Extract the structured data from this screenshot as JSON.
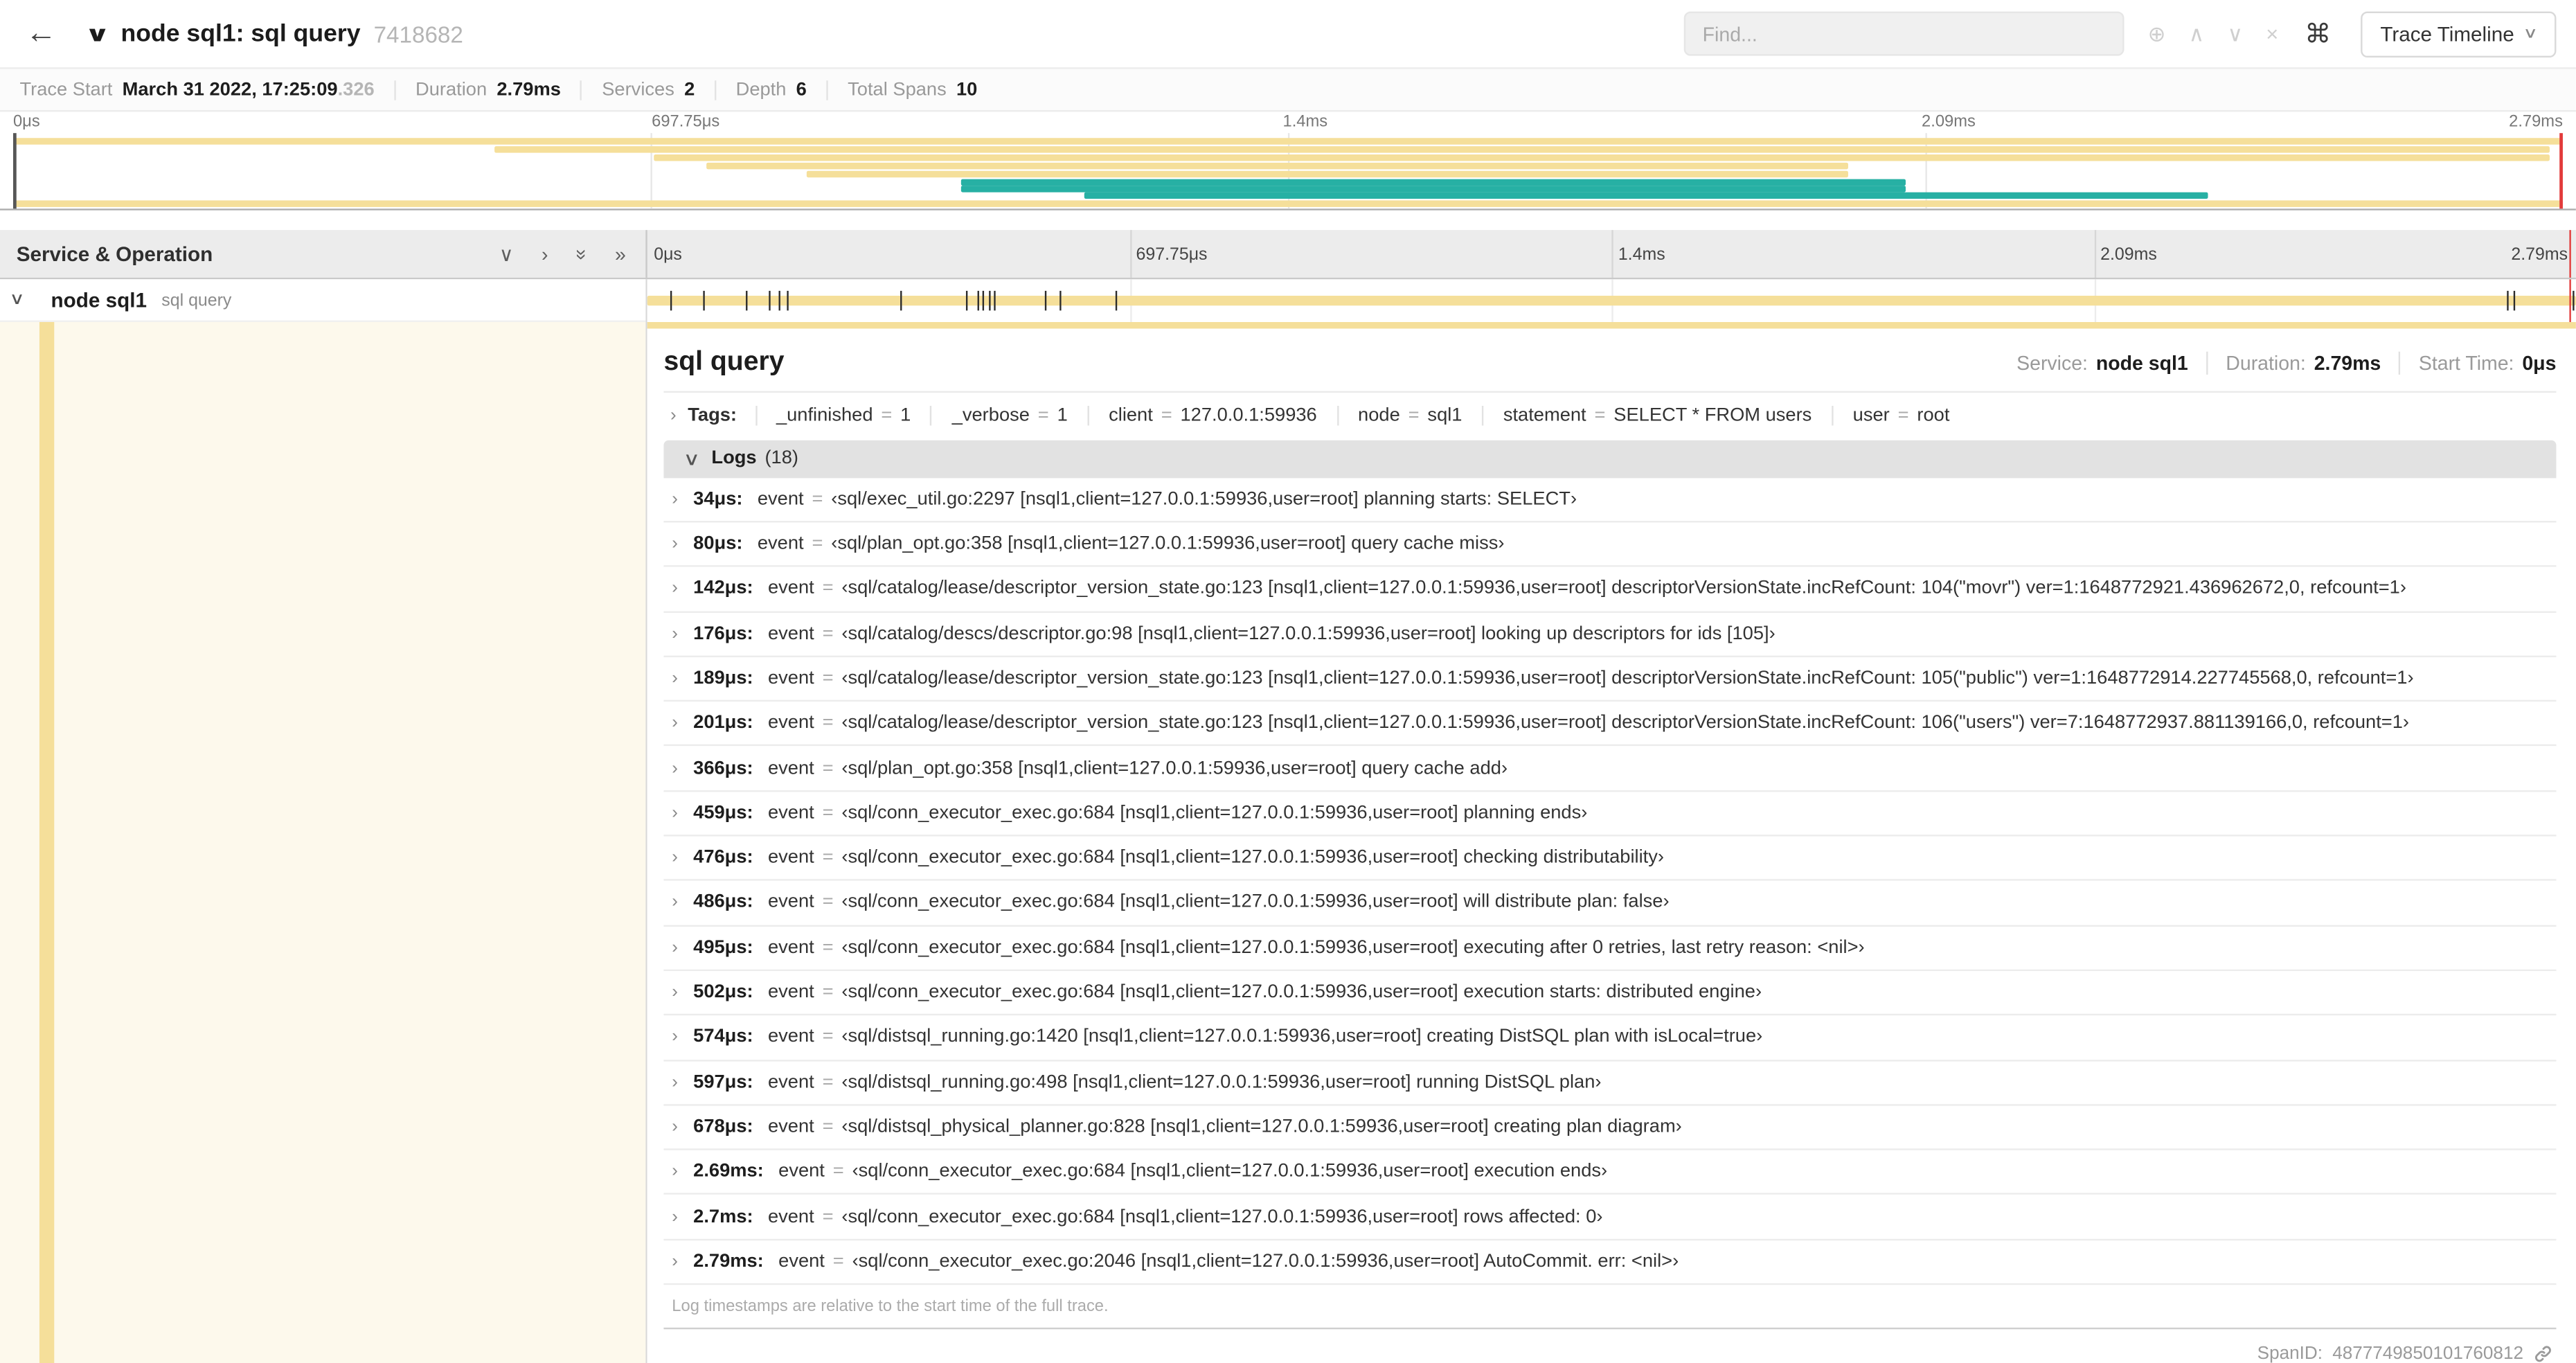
{
  "icons": {
    "back": "←",
    "title_chevron": "∨",
    "find_zoom": "⊕",
    "prev_result": "∧",
    "next_result": "∨",
    "clear_search": "×",
    "keyboard_shortcuts": "⌘",
    "dropdown_caret": "∨",
    "collapse_one": "∨",
    "expand_one": "›",
    "collapse_all": "»",
    "expand_all": "»",
    "span_toggle": "∨",
    "chevron_right": "›",
    "chevron_down": "∨"
  },
  "header": {
    "title": "node sql1: sql query",
    "trace_id": "7418682",
    "find_placeholder": "Find...",
    "trace_timeline_label": "Trace Timeline"
  },
  "summary": {
    "trace_start_label": "Trace Start",
    "trace_start_value": "March 31 2022, 17:25:09",
    "trace_start_ms": ".326",
    "duration_label": "Duration",
    "duration_value": "2.79ms",
    "services_label": "Services",
    "services_value": "2",
    "depth_label": "Depth",
    "depth_value": "6",
    "total_spans_label": "Total Spans",
    "total_spans_value": "10"
  },
  "ticks": [
    "0μs",
    "697.75μs",
    "1.4ms",
    "2.09ms",
    "2.79ms"
  ],
  "minimap": {
    "bars": [
      {
        "t": 3,
        "l": 0,
        "w": 100,
        "c": "#F5DF9A"
      },
      {
        "t": 8,
        "l": 18.9,
        "w": 80.6,
        "c": "#F5DF9A"
      },
      {
        "t": 13,
        "l": 25.1,
        "w": 74.4,
        "c": "#F5DF9A"
      },
      {
        "t": 18,
        "l": 27.2,
        "w": 44.8,
        "c": "#F5DF9A"
      },
      {
        "t": 23,
        "l": 31.1,
        "w": 40.9,
        "c": "#F5DF9A"
      },
      {
        "t": 28,
        "l": 37.2,
        "w": 37.0,
        "c": "#27B0A4"
      },
      {
        "t": 32,
        "l": 37.2,
        "w": 37.0,
        "c": "#27B0A4"
      },
      {
        "t": 36,
        "l": 42.0,
        "w": 44.1,
        "c": "#27B0A4"
      },
      {
        "t": 41,
        "l": 0,
        "w": 100,
        "c": "#F5DF9A"
      }
    ]
  },
  "timeline": {
    "left_title": "Service & Operation"
  },
  "span": {
    "service": "node sql1",
    "operation": "sql query",
    "markers": [
      {
        "l": 1.2
      },
      {
        "l": 2.9
      },
      {
        "l": 5.1
      },
      {
        "l": 6.3
      },
      {
        "l": 6.8
      },
      {
        "l": 7.2
      },
      {
        "l": 13.1
      },
      {
        "l": 16.5
      },
      {
        "l": 17.1
      },
      {
        "l": 17.4
      },
      {
        "l": 17.7
      },
      {
        "l": 18.0
      },
      {
        "l": 20.6
      },
      {
        "l": 21.4
      },
      {
        "l": 24.3
      },
      {
        "l": 96.4
      },
      {
        "l": 96.8
      },
      {
        "l": 99.8
      }
    ]
  },
  "misc": {
    "eq": "="
  },
  "colors": {
    "span_bar": "#F5DF9A",
    "teal": "#27B0A4",
    "scrubber_red": "#E23B3B"
  },
  "detail": {
    "title": "sql query",
    "service_label": "Service:",
    "service_value": "node sql1",
    "duration_label": "Duration:",
    "duration_value": "2.79ms",
    "start_time_label": "Start Time:",
    "start_time_value": "0μs",
    "tags_label": "Tags:",
    "tags": [
      {
        "key": "_unfinished",
        "value": "1"
      },
      {
        "key": "_verbose",
        "value": "1"
      },
      {
        "key": "client",
        "value": "127.0.0.1:59936"
      },
      {
        "key": "node",
        "value": "sql1"
      },
      {
        "key": "statement",
        "value": "SELECT * FROM users"
      },
      {
        "key": "user",
        "value": "root"
      }
    ],
    "logs_label": "Logs",
    "logs_count": "(18)",
    "logs": [
      {
        "time": "34μs:",
        "field": "event",
        "value": "‹sql/exec_util.go:2297 [nsql1,client=127.0.0.1:59936,user=root] planning starts: SELECT›"
      },
      {
        "time": "80μs:",
        "field": "event",
        "value": "‹sql/plan_opt.go:358 [nsql1,client=127.0.0.1:59936,user=root] query cache miss›"
      },
      {
        "time": "142μs:",
        "field": "event",
        "value": "‹sql/catalog/lease/descriptor_version_state.go:123 [nsql1,client=127.0.0.1:59936,user=root] descriptorVersionState.incRefCount: 104(\"movr\") ver=1:1648772921.436962672,0, refcount=1›"
      },
      {
        "time": "176μs:",
        "field": "event",
        "value": "‹sql/catalog/descs/descriptor.go:98 [nsql1,client=127.0.0.1:59936,user=root] looking up descriptors for ids [105]›"
      },
      {
        "time": "189μs:",
        "field": "event",
        "value": "‹sql/catalog/lease/descriptor_version_state.go:123 [nsql1,client=127.0.0.1:59936,user=root] descriptorVersionState.incRefCount: 105(\"public\") ver=1:1648772914.227745568,0, refcount=1›"
      },
      {
        "time": "201μs:",
        "field": "event",
        "value": "‹sql/catalog/lease/descriptor_version_state.go:123 [nsql1,client=127.0.0.1:59936,user=root] descriptorVersionState.incRefCount: 106(\"users\") ver=7:1648772937.881139166,0, refcount=1›"
      },
      {
        "time": "366μs:",
        "field": "event",
        "value": "‹sql/plan_opt.go:358 [nsql1,client=127.0.0.1:59936,user=root] query cache add›"
      },
      {
        "time": "459μs:",
        "field": "event",
        "value": "‹sql/conn_executor_exec.go:684 [nsql1,client=127.0.0.1:59936,user=root] planning ends›"
      },
      {
        "time": "476μs:",
        "field": "event",
        "value": "‹sql/conn_executor_exec.go:684 [nsql1,client=127.0.0.1:59936,user=root] checking distributability›"
      },
      {
        "time": "486μs:",
        "field": "event",
        "value": "‹sql/conn_executor_exec.go:684 [nsql1,client=127.0.0.1:59936,user=root] will distribute plan: false›"
      },
      {
        "time": "495μs:",
        "field": "event",
        "value": "‹sql/conn_executor_exec.go:684 [nsql1,client=127.0.0.1:59936,user=root] executing after 0 retries, last retry reason: <nil>›"
      },
      {
        "time": "502μs:",
        "field": "event",
        "value": "‹sql/conn_executor_exec.go:684 [nsql1,client=127.0.0.1:59936,user=root] execution starts: distributed engine›"
      },
      {
        "time": "574μs:",
        "field": "event",
        "value": "‹sql/distsql_running.go:1420 [nsql1,client=127.0.0.1:59936,user=root] creating DistSQL plan with isLocal=true›"
      },
      {
        "time": "597μs:",
        "field": "event",
        "value": "‹sql/distsql_running.go:498 [nsql1,client=127.0.0.1:59936,user=root] running DistSQL plan›"
      },
      {
        "time": "678μs:",
        "field": "event",
        "value": "‹sql/distsql_physical_planner.go:828 [nsql1,client=127.0.0.1:59936,user=root] creating plan diagram›"
      },
      {
        "time": "2.69ms:",
        "field": "event",
        "value": "‹sql/conn_executor_exec.go:684 [nsql1,client=127.0.0.1:59936,user=root] execution ends›"
      },
      {
        "time": "2.7ms:",
        "field": "event",
        "value": "‹sql/conn_executor_exec.go:684 [nsql1,client=127.0.0.1:59936,user=root] rows affected: 0›"
      },
      {
        "time": "2.79ms:",
        "field": "event",
        "value": "‹sql/conn_executor_exec.go:2046 [nsql1,client=127.0.0.1:59936,user=root] AutoCommit. err: <nil>›"
      }
    ],
    "logs_note": "Log timestamps are relative to the start time of the full trace.",
    "span_id_label": "SpanID:",
    "span_id_value": "4877749850101760812"
  }
}
